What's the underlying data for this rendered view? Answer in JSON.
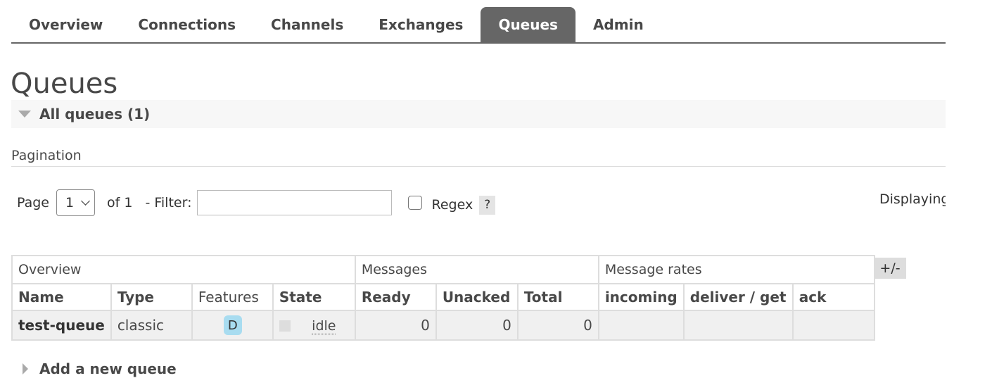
{
  "nav": {
    "tabs": [
      {
        "label": "Overview",
        "active": false
      },
      {
        "label": "Connections",
        "active": false
      },
      {
        "label": "Channels",
        "active": false
      },
      {
        "label": "Exchanges",
        "active": false
      },
      {
        "label": "Queues",
        "active": true
      },
      {
        "label": "Admin",
        "active": false
      }
    ]
  },
  "page": {
    "title": "Queues",
    "section_label": "All queues (1)"
  },
  "pagination": {
    "label": "Pagination",
    "page_label": "Page",
    "page_value": "1",
    "of_label": "of 1",
    "filter_label": "- Filter:",
    "filter_value": "",
    "regex_label": "Regex",
    "regex_checked": false,
    "help_label": "?",
    "displaying_text": "Displaying"
  },
  "table": {
    "groups": {
      "overview": "Overview",
      "messages": "Messages",
      "message_rates": "Message rates"
    },
    "headers": {
      "name": "Name",
      "type": "Type",
      "features": "Features",
      "state": "State",
      "ready": "Ready",
      "unacked": "Unacked",
      "total": "Total",
      "incoming": "incoming",
      "deliver_get": "deliver / get",
      "ack": "ack"
    },
    "rows": [
      {
        "name": "test-queue",
        "type": "classic",
        "features": "D",
        "state": "idle",
        "ready": "0",
        "unacked": "0",
        "total": "0",
        "incoming": "",
        "deliver_get": "",
        "ack": ""
      }
    ],
    "toggle_columns_label": "+/-"
  },
  "add_queue": {
    "label": "Add a new queue"
  },
  "colors": {
    "active_tab_bg": "#666666",
    "feature_badge_bg": "#a8dcf0",
    "row_bg": "#f0f0f0"
  }
}
